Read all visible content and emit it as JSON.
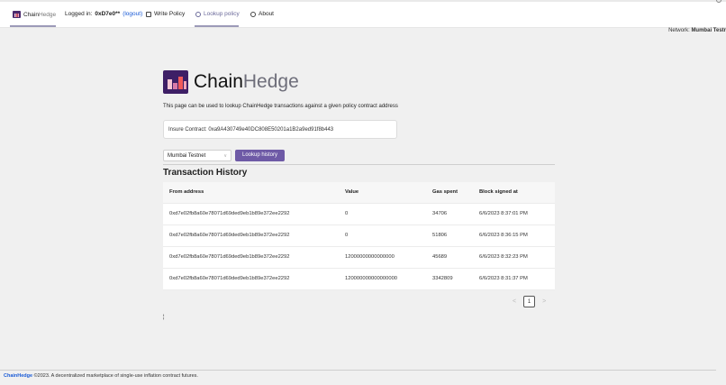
{
  "nav": {
    "brand_a": "Chain",
    "brand_b": "Hedge",
    "logged_in_prefix": "Logged in:",
    "user": "0xD7e0**",
    "logout": "(logout)",
    "write_policy": "Write Policy",
    "lookup_policy": "Lookup policy",
    "about": "About"
  },
  "network": {
    "label": "Network:",
    "value": "Mumbai Testr"
  },
  "header": {
    "title_a": "Chain",
    "title_b": "Hedge"
  },
  "description": "This page can be used to lookup ChainHedge transactions against a given policy contract address",
  "contract_input": {
    "value": "Insure Contract: 0xa9A430749e40DC808E50201a1B2a9ed91f8b443"
  },
  "network_select": {
    "selected": "Mumbai Testnet"
  },
  "lookup_button": "Lookup history",
  "section_title": "Transaction History",
  "table": {
    "headers": [
      "From address",
      "Value",
      "Gas spent",
      "Block signed at"
    ],
    "rows": [
      [
        "0xd7e02fb8a60e78071d69ded9eb1b89e372ee2292",
        "0",
        "34706",
        "6/6/2023 8:37:01 PM"
      ],
      [
        "0xd7e02fb8a60e78071d69ded9eb1b89e372ee2292",
        "0",
        "51806",
        "6/6/2023 8:36:15 PM"
      ],
      [
        "0xd7e02fb8a60e78071d69ded9eb1b89e372ee2292",
        "12000000000000000",
        "45689",
        "6/6/2023 8:32:23 PM"
      ],
      [
        "0xd7e02fb8a60e78071d69ded9eb1b89e372ee2292",
        "120000000000000000",
        "3342809",
        "6/6/2023 8:31:37 PM"
      ]
    ]
  },
  "pagination": {
    "current": "1",
    "prev": "<",
    "next": ">"
  },
  "caret": "¦",
  "footer": {
    "brand": "ChainHedge",
    "text": "©2023. A decentralized marketplace of single-use inflation contract futures."
  },
  "colors": {
    "accent": "#6e5aa6",
    "brand_dark": "#3e1f66",
    "link": "#1a5bd6"
  }
}
